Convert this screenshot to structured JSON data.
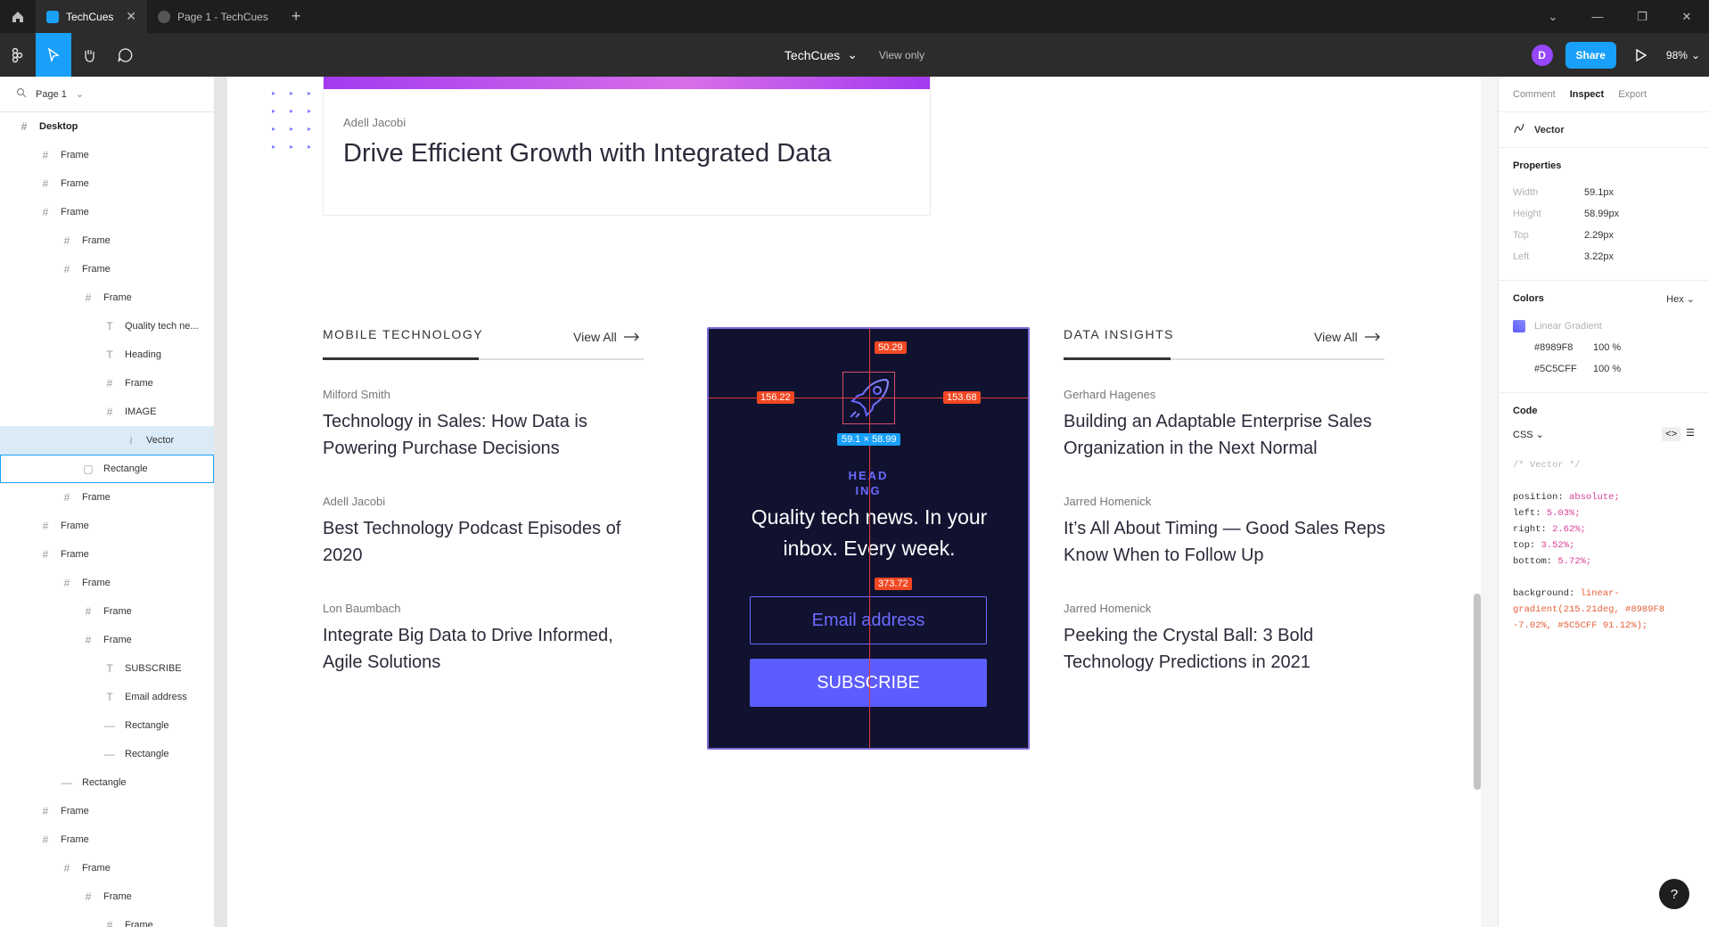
{
  "window": {
    "tabs": [
      {
        "label": "TechCues",
        "active": true
      },
      {
        "label": "Page 1 - TechCues",
        "active": false
      }
    ]
  },
  "toolbar": {
    "file_name": "TechCues",
    "view_mode": "View only",
    "avatar_initial": "D",
    "share_label": "Share",
    "zoom": "98%"
  },
  "layers": {
    "page_label": "Page 1",
    "items": [
      {
        "label": "Desktop",
        "icon": "frame-icon",
        "indent": 0
      },
      {
        "label": "Frame",
        "icon": "frame-icon",
        "indent": 1
      },
      {
        "label": "Frame",
        "icon": "frame-icon",
        "indent": 1
      },
      {
        "label": "Frame",
        "icon": "frame-icon",
        "indent": 1
      },
      {
        "label": "Frame",
        "icon": "frame-icon",
        "indent": 2
      },
      {
        "label": "Frame",
        "icon": "frame-icon",
        "indent": 2
      },
      {
        "label": "Frame",
        "icon": "frame-icon",
        "indent": 3
      },
      {
        "label": "Quality tech ne...",
        "icon": "text-icon",
        "indent": 4
      },
      {
        "label": "Heading",
        "icon": "text-icon",
        "indent": 4
      },
      {
        "label": "Frame",
        "icon": "frame-icon",
        "indent": 4
      },
      {
        "label": "IMAGE",
        "icon": "frame-icon",
        "indent": 4
      },
      {
        "label": "Vector",
        "icon": "vector-icon",
        "indent": 5
      },
      {
        "label": "Rectangle",
        "icon": "rectangle-icon",
        "indent": 3
      },
      {
        "label": "Frame",
        "icon": "frame-icon",
        "indent": 2
      },
      {
        "label": "Frame",
        "icon": "frame-icon",
        "indent": 1
      },
      {
        "label": "Frame",
        "icon": "frame-icon",
        "indent": 1
      },
      {
        "label": "Frame",
        "icon": "frame-icon",
        "indent": 2
      },
      {
        "label": "Frame",
        "icon": "frame-icon",
        "indent": 3
      },
      {
        "label": "Frame",
        "icon": "frame-icon",
        "indent": 3
      },
      {
        "label": "SUBSCRIBE",
        "icon": "text-icon",
        "indent": 4
      },
      {
        "label": "Email address",
        "icon": "text-icon",
        "indent": 4
      },
      {
        "label": "Rectangle",
        "icon": "line-icon",
        "indent": 4
      },
      {
        "label": "Rectangle",
        "icon": "line-icon",
        "indent": 4
      },
      {
        "label": "Rectangle",
        "icon": "line-icon",
        "indent": 2
      },
      {
        "label": "Frame",
        "icon": "frame-icon",
        "indent": 1
      },
      {
        "label": "Frame",
        "icon": "frame-icon",
        "indent": 1
      },
      {
        "label": "Frame",
        "icon": "frame-icon",
        "indent": 2
      },
      {
        "label": "Frame",
        "icon": "frame-icon",
        "indent": 3
      },
      {
        "label": "Frame",
        "icon": "frame-icon",
        "indent": 4
      }
    ],
    "selected_index": 11,
    "hovered_index": 12
  },
  "canvas": {
    "top_card": {
      "author": "Adell Jacobi",
      "title": "Drive Efficient Growth with Integrated Data"
    },
    "mobile": {
      "heading": "MOBILE TECHNOLOGY",
      "view_all": "View All",
      "articles": [
        {
          "author": "Milford Smith",
          "title": "Technology in Sales: How Data is Powering Purchase Decisions"
        },
        {
          "author": "Adell Jacobi",
          "title": "Best Technology Podcast Episodes of 2020"
        },
        {
          "author": "Lon Baumbach",
          "title": "Integrate Big Data to Drive Informed, Agile Solutions"
        }
      ]
    },
    "data_insights": {
      "heading": "DATA INSIGHTS",
      "view_all": "View All",
      "articles": [
        {
          "author": "Gerhard Hagenes",
          "title": "Building an Adaptable Enterprise Sales Organization in the Next Normal"
        },
        {
          "author": "Jarred Homenick",
          "title": "It’s All About Timing — Good Sales Reps Know When to Follow Up"
        },
        {
          "author": "Jarred Homenick",
          "title": "Peeking the Crystal Ball: 3 Bold Technology Predictions in 2021"
        }
      ]
    },
    "newsletter": {
      "heading_line1": "HEAD",
      "heading_line2": "ING",
      "text": "Quality tech news. In your inbox. Every week.",
      "email_placeholder": "Email address",
      "subscribe_label": "SUBSCRIBE"
    },
    "measurements": {
      "top": "50.29",
      "left": "156.22",
      "right": "153.68",
      "bottom": "373.72",
      "size": "59.1 × 58.99"
    }
  },
  "inspect": {
    "tabs": [
      "Comment",
      "Inspect",
      "Export"
    ],
    "active_tab": "Inspect",
    "layer_name": "Vector",
    "properties_title": "Properties",
    "properties": [
      {
        "key": "Width",
        "value": "59.1px"
      },
      {
        "key": "Height",
        "value": "58.99px"
      },
      {
        "key": "Top",
        "value": "2.29px"
      },
      {
        "key": "Left",
        "value": "3.22px"
      }
    ],
    "colors_title": "Colors",
    "color_format": "Hex",
    "fill_type": "Linear Gradient",
    "color_stops": [
      {
        "hex": "#8989F8",
        "opacity": "100 %"
      },
      {
        "hex": "#5C5CFF",
        "opacity": "100 %"
      }
    ],
    "code_title": "Code",
    "code_lang": "CSS",
    "code_comment": "/* Vector */",
    "code_lines": [
      {
        "prop": "position:",
        "value": "absolute;"
      },
      {
        "prop": "left:",
        "value": "5.03%;"
      },
      {
        "prop": "right:",
        "value": "2.62%;"
      },
      {
        "prop": "top:",
        "value": "3.52%;"
      },
      {
        "prop": "bottom:",
        "value": "5.72%;"
      }
    ],
    "code_bg_prop": "background:",
    "code_bg_value": "linear-gradient(215.21deg, #8989F8 -7.02%, #5C5CFF 91.12%);"
  },
  "help_label": "?",
  "colors": {
    "accent": "#18A0FB",
    "newsletter_bg": "#111230",
    "brand_purple": "#5C5CFF"
  }
}
